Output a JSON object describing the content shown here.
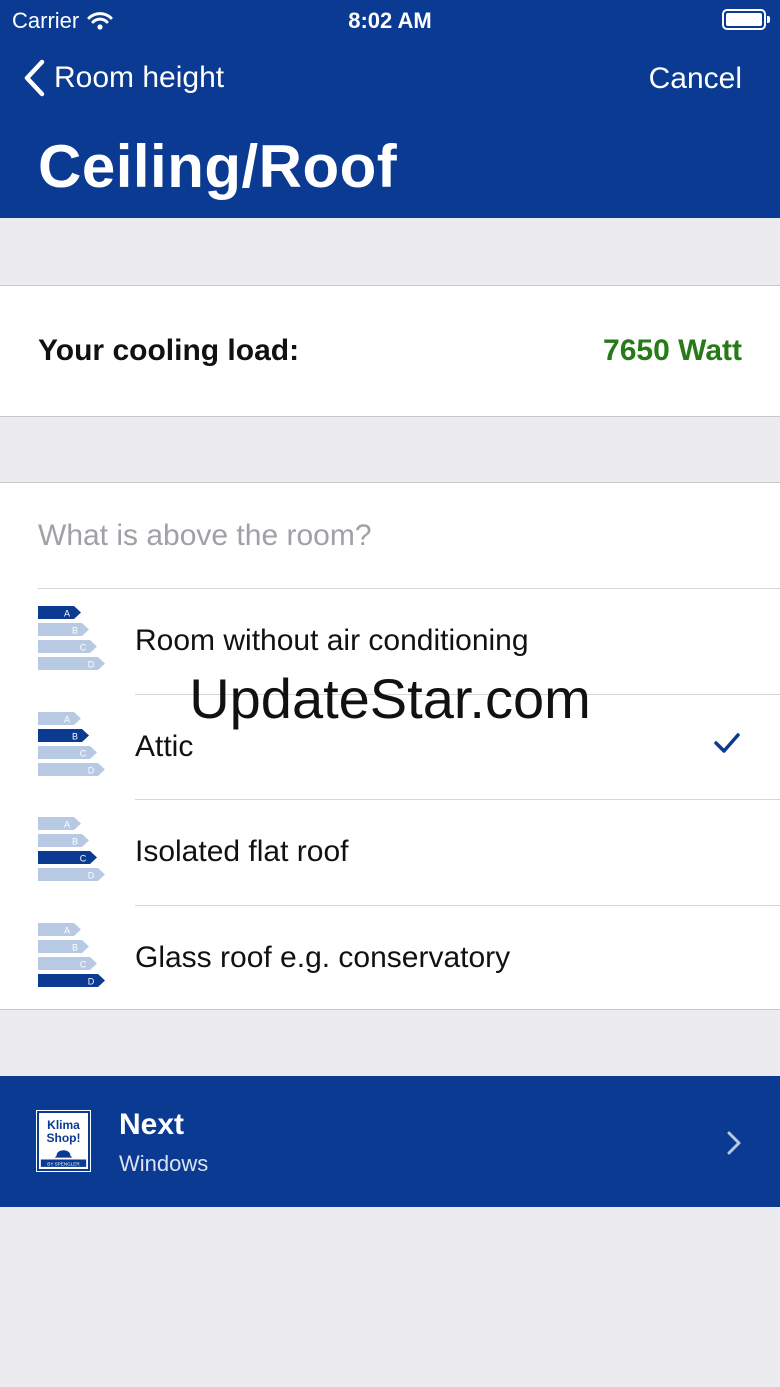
{
  "status_bar": {
    "carrier": "Carrier",
    "time": "8:02 AM"
  },
  "nav": {
    "back_label": "Room height",
    "cancel_label": "Cancel",
    "title": "Ceiling/Roof"
  },
  "cooling_load": {
    "label": "Your cooling load:",
    "value": "7650 Watt"
  },
  "question": "What is above the room?",
  "energy_letters": [
    "A",
    "B",
    "C",
    "D"
  ],
  "options": [
    {
      "label": "Room without air conditioning",
      "rating": "A",
      "selected": false
    },
    {
      "label": "Attic",
      "rating": "B",
      "selected": true
    },
    {
      "label": "Isolated flat roof",
      "rating": "C",
      "selected": false
    },
    {
      "label": "Glass roof e.g. conservatory",
      "rating": "D",
      "selected": false
    }
  ],
  "next": {
    "title": "Next",
    "subtitle": "Windows",
    "logo_text": [
      "Klima",
      "Shop!",
      "BY SPENGLER"
    ]
  },
  "watermark": "UpdateStar.com",
  "colors": {
    "brand_blue": "#0a3a91",
    "light_bar": "#b8c9e4",
    "value_green": "#267a17",
    "background": "#ebebf0"
  }
}
